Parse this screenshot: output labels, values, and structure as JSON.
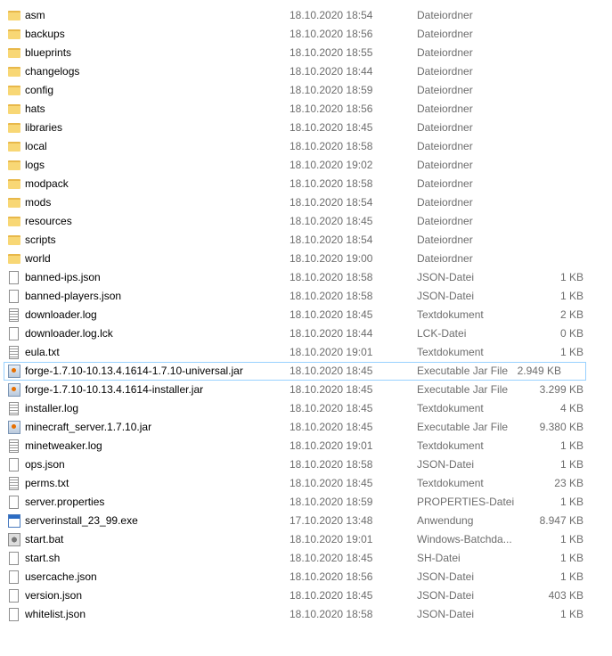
{
  "files": [
    {
      "name": "asm",
      "date": "18.10.2020 18:54",
      "type": "Dateiordner",
      "size": "",
      "icon": "folder"
    },
    {
      "name": "backups",
      "date": "18.10.2020 18:56",
      "type": "Dateiordner",
      "size": "",
      "icon": "folder"
    },
    {
      "name": "blueprints",
      "date": "18.10.2020 18:55",
      "type": "Dateiordner",
      "size": "",
      "icon": "folder"
    },
    {
      "name": "changelogs",
      "date": "18.10.2020 18:44",
      "type": "Dateiordner",
      "size": "",
      "icon": "folder"
    },
    {
      "name": "config",
      "date": "18.10.2020 18:59",
      "type": "Dateiordner",
      "size": "",
      "icon": "folder"
    },
    {
      "name": "hats",
      "date": "18.10.2020 18:56",
      "type": "Dateiordner",
      "size": "",
      "icon": "folder"
    },
    {
      "name": "libraries",
      "date": "18.10.2020 18:45",
      "type": "Dateiordner",
      "size": "",
      "icon": "folder"
    },
    {
      "name": "local",
      "date": "18.10.2020 18:58",
      "type": "Dateiordner",
      "size": "",
      "icon": "folder"
    },
    {
      "name": "logs",
      "date": "18.10.2020 19:02",
      "type": "Dateiordner",
      "size": "",
      "icon": "folder"
    },
    {
      "name": "modpack",
      "date": "18.10.2020 18:58",
      "type": "Dateiordner",
      "size": "",
      "icon": "folder"
    },
    {
      "name": "mods",
      "date": "18.10.2020 18:54",
      "type": "Dateiordner",
      "size": "",
      "icon": "folder"
    },
    {
      "name": "resources",
      "date": "18.10.2020 18:45",
      "type": "Dateiordner",
      "size": "",
      "icon": "folder"
    },
    {
      "name": "scripts",
      "date": "18.10.2020 18:54",
      "type": "Dateiordner",
      "size": "",
      "icon": "folder"
    },
    {
      "name": "world",
      "date": "18.10.2020 19:00",
      "type": "Dateiordner",
      "size": "",
      "icon": "folder"
    },
    {
      "name": "banned-ips.json",
      "date": "18.10.2020 18:58",
      "type": "JSON-Datei",
      "size": "1 KB",
      "icon": "doc"
    },
    {
      "name": "banned-players.json",
      "date": "18.10.2020 18:58",
      "type": "JSON-Datei",
      "size": "1 KB",
      "icon": "doc"
    },
    {
      "name": "downloader.log",
      "date": "18.10.2020 18:45",
      "type": "Textdokument",
      "size": "2 KB",
      "icon": "txt"
    },
    {
      "name": "downloader.log.lck",
      "date": "18.10.2020 18:44",
      "type": "LCK-Datei",
      "size": "0 KB",
      "icon": "doc"
    },
    {
      "name": "eula.txt",
      "date": "18.10.2020 19:01",
      "type": "Textdokument",
      "size": "1 KB",
      "icon": "txt"
    },
    {
      "name": "forge-1.7.10-10.13.4.1614-1.7.10-universal.jar",
      "date": "18.10.2020 18:45",
      "type": "Executable Jar File",
      "size": "2.949 KB",
      "icon": "jar",
      "focused": true
    },
    {
      "name": "forge-1.7.10-10.13.4.1614-installer.jar",
      "date": "18.10.2020 18:45",
      "type": "Executable Jar File",
      "size": "3.299 KB",
      "icon": "jar"
    },
    {
      "name": "installer.log",
      "date": "18.10.2020 18:45",
      "type": "Textdokument",
      "size": "4 KB",
      "icon": "txt"
    },
    {
      "name": "minecraft_server.1.7.10.jar",
      "date": "18.10.2020 18:45",
      "type": "Executable Jar File",
      "size": "9.380 KB",
      "icon": "jar"
    },
    {
      "name": "minetweaker.log",
      "date": "18.10.2020 19:01",
      "type": "Textdokument",
      "size": "1 KB",
      "icon": "txt"
    },
    {
      "name": "ops.json",
      "date": "18.10.2020 18:58",
      "type": "JSON-Datei",
      "size": "1 KB",
      "icon": "doc"
    },
    {
      "name": "perms.txt",
      "date": "18.10.2020 18:45",
      "type": "Textdokument",
      "size": "23 KB",
      "icon": "txt"
    },
    {
      "name": "server.properties",
      "date": "18.10.2020 18:59",
      "type": "PROPERTIES-Datei",
      "size": "1 KB",
      "icon": "doc"
    },
    {
      "name": "serverinstall_23_99.exe",
      "date": "17.10.2020 13:48",
      "type": "Anwendung",
      "size": "8.947 KB",
      "icon": "exe"
    },
    {
      "name": "start.bat",
      "date": "18.10.2020 19:01",
      "type": "Windows-Batchda...",
      "size": "1 KB",
      "icon": "bat"
    },
    {
      "name": "start.sh",
      "date": "18.10.2020 18:45",
      "type": "SH-Datei",
      "size": "1 KB",
      "icon": "doc"
    },
    {
      "name": "usercache.json",
      "date": "18.10.2020 18:56",
      "type": "JSON-Datei",
      "size": "1 KB",
      "icon": "doc"
    },
    {
      "name": "version.json",
      "date": "18.10.2020 18:45",
      "type": "JSON-Datei",
      "size": "403 KB",
      "icon": "doc"
    },
    {
      "name": "whitelist.json",
      "date": "18.10.2020 18:58",
      "type": "JSON-Datei",
      "size": "1 KB",
      "icon": "doc"
    }
  ]
}
